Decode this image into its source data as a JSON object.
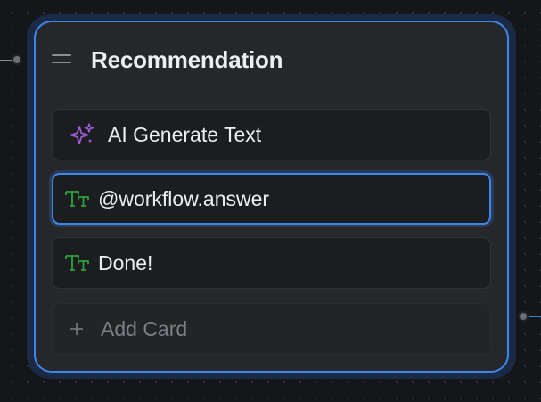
{
  "node": {
    "title": "Recommendation",
    "cards": [
      {
        "label": "AI Generate Text",
        "icon": "sparkle-icon",
        "icon_color": "#a05ad4"
      },
      {
        "label": "@workflow.answer",
        "icon": "text-format-icon",
        "icon_color": "#2fa33c",
        "selected": true
      },
      {
        "label": "Done!",
        "icon": "text-format-icon",
        "icon_color": "#2fa33c"
      }
    ],
    "add_card_label": "Add Card"
  },
  "colors": {
    "accent": "#3f86ea",
    "canvas": "#151618",
    "node_background": "#25272b"
  }
}
